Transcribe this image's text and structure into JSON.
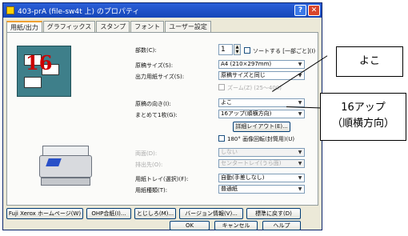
{
  "window": {
    "title": "403-prA (file-sw4t 上) のプロパティ",
    "help_btn": "?",
    "close_btn": "✕"
  },
  "tabs": [
    "用紙/出力",
    "グラフィックス",
    "スタンプ",
    "フォント",
    "ユーザー設定"
  ],
  "form": {
    "copies_label": "部数(C):",
    "copies_value": "1",
    "sort_label": "ソートする [一部ごと](I)",
    "doc_size_label": "原稿サイズ(S):",
    "doc_size_value": "A4 (210×297mm)",
    "out_size_label": "出力用紙サイズ(S):",
    "out_size_value": "原稿サイズと同じ",
    "zoom_label": "ズーム(Z)  (25〜400)",
    "orientation_label": "原稿の向き(I):",
    "orientation_value": "よこ",
    "nup_label": "まとめて1枚(G):",
    "nup_value": "16アップ(順横方向)",
    "detail_layout_btn": "詳細レイアウト(E)...",
    "rotate_label": "180° 画像回転(封筒用)(U)",
    "duplex_label": "両面(D):",
    "duplex_value": "しない",
    "output_tray_label": "排出先(O):",
    "output_tray_value": "センタートレイ(うら面)",
    "paper_tray_label": "用紙トレイ(選択)(F):",
    "paper_tray_value": "自動(手差しなし)",
    "paper_type_label": "用紙種類(T):",
    "paper_type_value": "普通紙"
  },
  "preview": {
    "number": "16"
  },
  "bottom_links": {
    "homepage": "Fuji Xerox ホームページ(W)",
    "ohp": "OHP合紙(I)...",
    "misc": "とじしろ(M)...",
    "version": "バージョン情報(V)...",
    "default": "標準に戻す(D)"
  },
  "buttons": {
    "ok": "OK",
    "cancel": "キャンセル",
    "help": "ヘルプ"
  },
  "callouts": {
    "orientation": "よこ",
    "nup_line1": "16アップ",
    "nup_line2": "（順横方向）"
  },
  "colors": {
    "titlebar": "#2b5fd9",
    "dialog_bg": "#ece9d8",
    "preview_bg": "#3e7f8a"
  }
}
